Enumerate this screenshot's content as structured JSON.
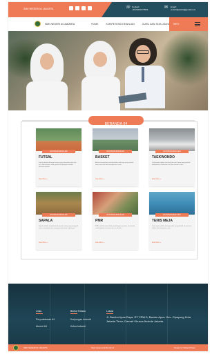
{
  "topbar": {
    "school_name": "SMK NEGERI 64 JAKARTA",
    "social_icons": [
      "facebook-icon",
      "instagram-icon",
      "youtube-icon",
      "twitter-icon"
    ],
    "phone_label": "Contact :",
    "phone_value": "+6221000170534",
    "email_label": "Email :",
    "email_value": "smkn64jakarta@gmail.com",
    "accent": "#ef7a56",
    "dark": "#234e5e"
  },
  "nav": {
    "brand": "SMK NEGERI 64 JAKARTA",
    "items": [
      {
        "label": "HOME"
      },
      {
        "label": "KOMPETENSI KEAHLIAN"
      },
      {
        "label": "GURU DAN TATA USAHA"
      }
    ],
    "active_label": "INFO",
    "menu_icon": "hamburger-icon"
  },
  "section": {
    "title": "BERANDA 64"
  },
  "cards": [
    {
      "title": "FUTSAL",
      "tag": "EKSTRAKURIKULER",
      "desc": "Futsal adalah olahraga beregu yang dimainkan oleh dua tim, dilaksanakan setiap pekan di lapangan sekolah bersama pelatih.",
      "more": "Read More »"
    },
    {
      "title": "BASKET",
      "tag": "EKSTRAKURIKULER",
      "desc": "Basket merupakan ekstrakurikuler olahraga yang melatih kerja sama tim dan ketangkasan siswa.",
      "more": "Read More »"
    },
    {
      "title": "TAEKWONDO",
      "tag": "EKSTRAKURIKULER",
      "desc": "Taekwondo adalah seni bela diri asal Korea yang melatih kedisiplinan, ketahanan fisik dan mental siswa.",
      "more": "Read More »"
    },
    {
      "title": "SAPALA",
      "tag": "EKSTRAKURIKULER",
      "desc": "Sapala adalah ekstrakurikuler pecinta alam yang mengajak siswa menjelajah dan menjaga kelestarian lingkungan.",
      "more": "Read More »"
    },
    {
      "title": "PMR",
      "tag": "EKSTRAKURIKULER",
      "desc": "PMR melatih siswa dalam pertolongan pertama, kesehatan, serta kegiatan kemanusiaan di sekolah.",
      "more": "Read More »"
    },
    {
      "title": "TENIS MEJA",
      "tag": "EKSTRAKURIKULER",
      "desc": "Tenis meja adalah olahraga raket yang melatih konsentrasi, refleks dan ketepatan siswa.",
      "more": "Read More »"
    }
  ],
  "footer": {
    "links_title": "Links",
    "links": [
      "Perpustakaan 64",
      "Alumni 64"
    ],
    "news_title": "Berita Terbaru",
    "news": [
      "Kunjungan Industri",
      "Kelas Industri"
    ],
    "location_title": "Lokasi",
    "address": "Jl. Bambu Apus Raya, RT.7/RW.3, Bambu Apus, Kec. Cipayung Kota Jakarta Timur, Daerah Khusus Ibukota Jakarta",
    "bottom_left": "SMK NEGERI 64 JAKARTA",
    "bottom_mid": "https://www.smkn64.sch.id",
    "bottom_right": "Design by Srikandi Team"
  }
}
